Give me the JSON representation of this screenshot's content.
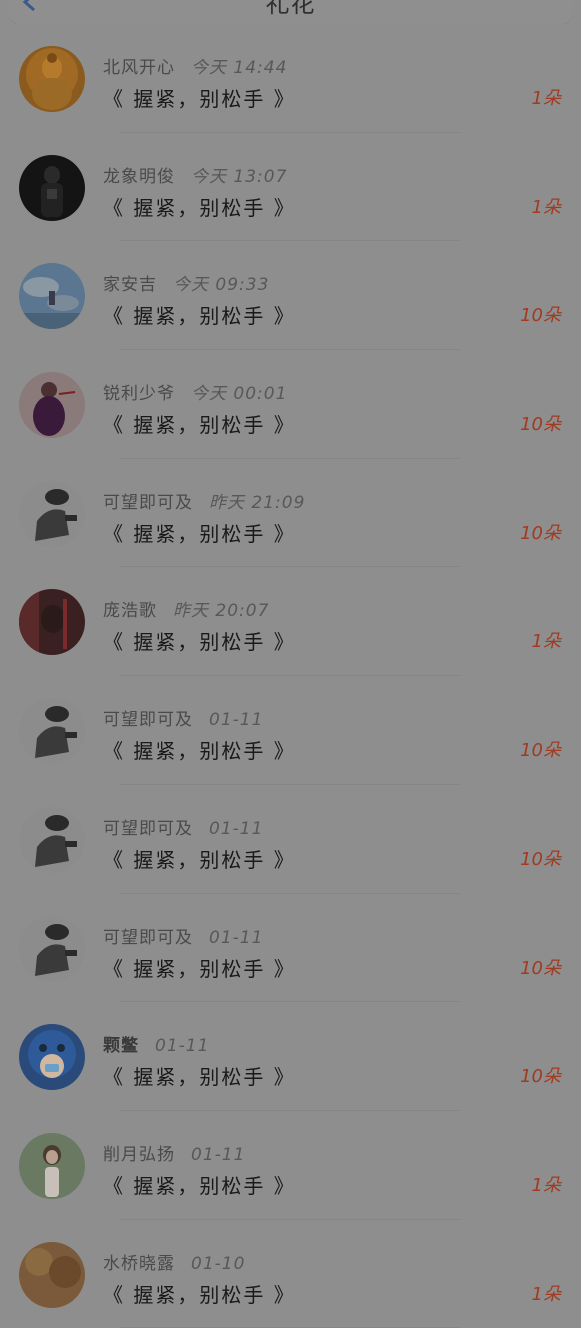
{
  "header": {
    "title": "礼花"
  },
  "colors": {
    "count": "#a13a20",
    "overlay": "#8e8e8e"
  },
  "rows": [
    {
      "name": "北风开心",
      "time": "今天 14:44",
      "gift": "《 握紧，别松手 》",
      "count": "1朵",
      "avatar": "buddha"
    },
    {
      "name": "龙象明俊",
      "time": "今天 13:07",
      "gift": "《 握紧，别松手 》",
      "count": "1朵",
      "avatar": "dark-figure"
    },
    {
      "name": "家安吉",
      "time": "今天 09:33",
      "gift": "《 握紧，别松手 》",
      "count": "10朵",
      "avatar": "sky"
    },
    {
      "name": "锐利少爷",
      "time": "今天 00:01",
      "gift": "《 握紧，别松手 》",
      "count": "10朵",
      "avatar": "girl-purple"
    },
    {
      "name": "可望即可及",
      "time": "昨天 21:09",
      "gift": "《 握紧，别松手 》",
      "count": "10朵",
      "avatar": "rider"
    },
    {
      "name": "庞浩歌",
      "time": "昨天 20:07",
      "gift": "《 握紧，别松手 》",
      "count": "1朵",
      "avatar": "dark-red"
    },
    {
      "name": "可望即可及",
      "time": "01-11",
      "gift": "《 握紧，别松手 》",
      "count": "10朵",
      "avatar": "rider"
    },
    {
      "name": "可望即可及",
      "time": "01-11",
      "gift": "《 握紧，别松手 》",
      "count": "10朵",
      "avatar": "rider"
    },
    {
      "name": "可望即可及",
      "time": "01-11",
      "gift": "《 握紧，别松手 》",
      "count": "10朵",
      "avatar": "rider"
    },
    {
      "name": "颗鳖",
      "time": "01-11",
      "gift": "《 握紧，别松手 》",
      "count": "10朵",
      "avatar": "stitch",
      "bold": true
    },
    {
      "name": "削月弘扬",
      "time": "01-11",
      "gift": "《 握紧，别松手 》",
      "count": "1朵",
      "avatar": "girl-outdoor"
    },
    {
      "name": "水桥晓露",
      "time": "01-10",
      "gift": "《 握紧，别松手 》",
      "count": "1朵",
      "avatar": "autumn"
    }
  ]
}
